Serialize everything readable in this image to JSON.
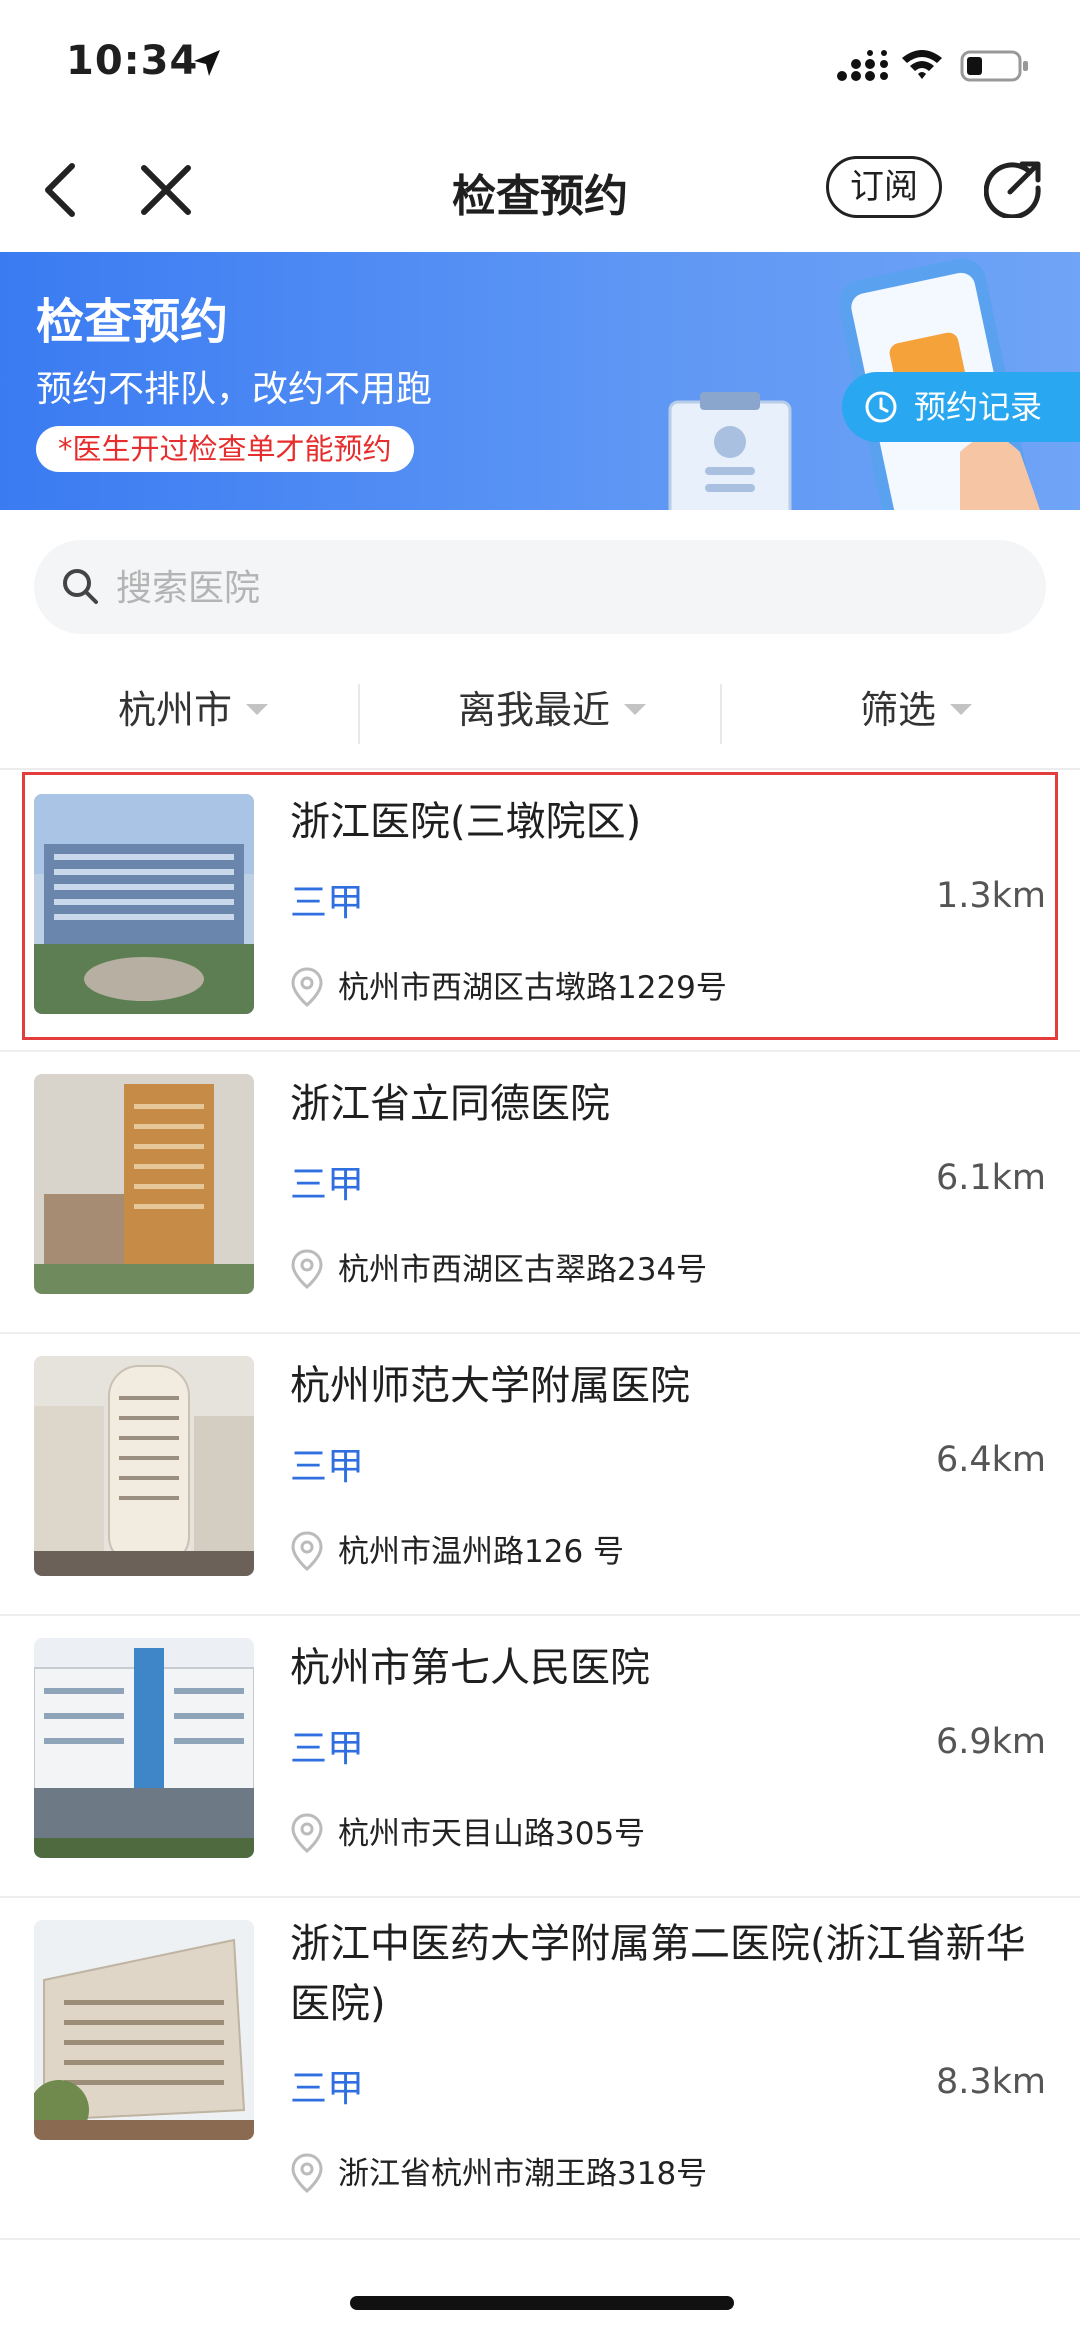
{
  "status_bar": {
    "time": "10:34"
  },
  "nav": {
    "title": "检查预约",
    "subscribe_label": "订阅"
  },
  "banner": {
    "title": "检查预约",
    "subtitle": "预约不排队，改约不用跑",
    "note": "*医生开过检查单才能预约",
    "record_label": "预约记录"
  },
  "search": {
    "placeholder": "搜索医院",
    "value": ""
  },
  "filters": [
    {
      "label": "杭州市"
    },
    {
      "label": "离我最近"
    },
    {
      "label": "筛选"
    }
  ],
  "hospitals": [
    {
      "name": "浙江医院(三墩院区)",
      "grade": "三甲",
      "distance": "1.3km",
      "address": "杭州市西湖区古墩路1229号"
    },
    {
      "name": "浙江省立同德医院",
      "grade": "三甲",
      "distance": "6.1km",
      "address": "杭州市西湖区古翠路234号"
    },
    {
      "name": "杭州师范大学附属医院",
      "grade": "三甲",
      "distance": "6.4km",
      "address": "杭州市温州路126 号"
    },
    {
      "name": "杭州市第七人民医院",
      "grade": "三甲",
      "distance": "6.9km",
      "address": "杭州市天目山路305号"
    },
    {
      "name": "浙江中医药大学附属第二医院(浙江省新华医院)",
      "grade": "三甲",
      "distance": "8.3km",
      "address": "浙江省杭州市潮王路318号"
    }
  ],
  "colors": {
    "accent": "#2f6fe0",
    "banner": "#3a7bf2",
    "note_red": "#e62e2e",
    "highlight": "#e23c3c"
  }
}
